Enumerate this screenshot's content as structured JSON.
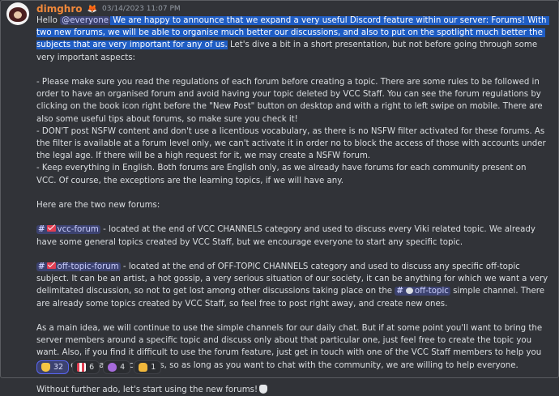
{
  "message": {
    "username": "dimghro",
    "badge_icon": "fox-icon",
    "timestamp": "03/14/2023 11:07 PM",
    "p1_hello": "Hello ",
    "p1_mention": "@everyone",
    "p1_highlight": " We are happy to announce that we expand a very useful Discord feature within our server: Forums! With two new forums, we will be able to organise much better our discussions, and also to put on the spotlight much better the subjects that are very important for any of us.",
    "p1_rest": " Let's dive a bit in a short presentation, but not before going through some very important aspects:",
    "p2_rule1": "- Please make sure you read the regulations of each forum before creating a topic. There are some rules to be followed in order to have an organised forum and avoid having your topic deleted by VCC Staff. You can see the forum regulations by clicking on the book icon right before the \"New Post\" button on desktop and with a right to left swipe on mobile. There are also some useful tips about forums, so make sure you check it!",
    "p2_rule2": "- DON'T post NSFW content and don't use a licentious vocabulary, as there is no NSFW filter activated for these forums. As the filter is available at a forum level only, we can't activate it in order no to block the access of those with accounts under the legal age. If there will be a high request for it, we may create a NSFW forum.",
    "p2_rule3": "- Keep everything in English. Both forums are English only, as we already have forums for each community present on VCC. Of course, the exceptions are the learning topics, if we will have any.",
    "p3": "Here are the two new forums:",
    "forum1_channel": "vcc-forum",
    "forum1_text": " - located at the end of VCC CHANNELS category and used to discuss every Viki related topic. We already have some general topics created by VCC Staff, but we encourage everyone to start any specific topic.",
    "forum2_channel": "off-topic-forum",
    "forum2_text_a": " - located at the end of OFF-TOPIC CHANNELS category and used to discuss any specific off-topic subject. It can be an artist, a hot gossip, a very serious situation of our society, it can be anything for which we want a very delimitated discussion, so not to get lost among other discussions taking place on the ",
    "forum2_channel_b": "off-topic",
    "forum2_text_b": " simple channel. There are already some topics created by VCC Staff, so feel free to post right away, and create new ones.",
    "p6": "As a main idea, we will continue to use the simple channels for our daily chat. But if at some point you'll want to bring the server members around a specific topic and discuss only about that particular one, just feel free to create the topic you want. Also, if you find it difficult to use the forum feature, just get in touch with one of the VCC Staff members to help you out. We encourage discussions, so as long as you want to chat with the community, we are willing to help everyone.",
    "p7": "Without further ado, let's start using the new forums!",
    "p7_emoji": "thumbs-down-emoji"
  },
  "reactions": [
    {
      "icon": "thumbs-up-icon",
      "count": "32"
    },
    {
      "icon": "flag-icon",
      "count": "6"
    },
    {
      "icon": "purple-heart-icon",
      "count": "4"
    },
    {
      "icon": "hand-sign-icon",
      "count": "1"
    }
  ],
  "colors": {
    "background": "#313338",
    "username": "#f0883a",
    "selection": "#1f5dc4",
    "mention_bg": "#3c4270",
    "mention_text": "#c9cdfb"
  }
}
